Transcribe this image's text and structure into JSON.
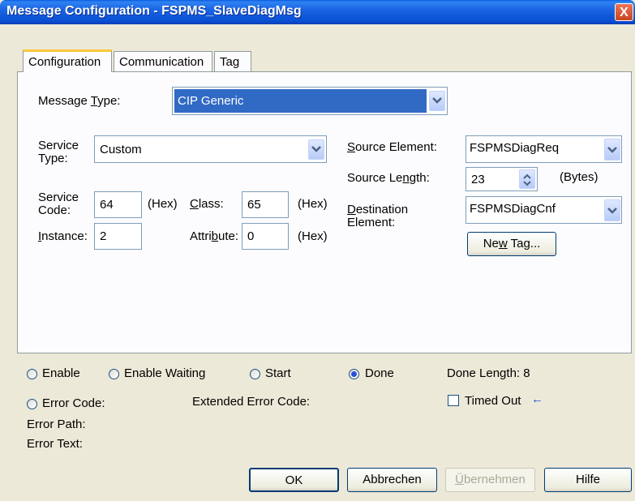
{
  "window": {
    "title": "Message Configuration - FSPMS_SlaveDiagMsg",
    "close_glyph": "X"
  },
  "tabs": [
    {
      "label": "Configuration",
      "active": true
    },
    {
      "label": "Communication",
      "active": false
    },
    {
      "label": "Tag",
      "active": false
    }
  ],
  "config": {
    "message_type": {
      "label_a": "Message ",
      "label_u": "T",
      "label_b": "ype:",
      "value": "CIP Generic"
    },
    "service_type": {
      "label_l1": "Service",
      "label_l2": "Type:",
      "value": "Custom"
    },
    "service_code": {
      "label_l1": "Service",
      "label_l2": "Code:",
      "value": "64",
      "unit": "(Hex)"
    },
    "class": {
      "label_u": "C",
      "label_b": "lass:",
      "value": "65",
      "unit": "(Hex)"
    },
    "instance": {
      "label_u": "I",
      "label_b": "nstance:",
      "value": "2"
    },
    "attribute": {
      "label_a": "Attri",
      "label_u": "b",
      "label_b": "ute:",
      "value": "0",
      "unit": "(Hex)"
    },
    "source_element": {
      "label_u": "S",
      "label_b": "ource Element:",
      "value": "FSPMSDiagReq"
    },
    "source_length": {
      "label_a": "Source Le",
      "label_u": "n",
      "label_b": "gth:",
      "value": "23",
      "unit": "(Bytes)"
    },
    "destination_element": {
      "label_u": "D",
      "label_b": "estination",
      "label_l2": "Element:",
      "value": "FSPMSDiagCnf"
    },
    "new_tag_button": {
      "label_a": "Ne",
      "label_u": "w",
      "label_b": " Tag..."
    }
  },
  "status": {
    "enable": "Enable",
    "enable_waiting": "Enable Waiting",
    "start": "Start",
    "done": "Done",
    "done_length_label": "Done Length: 8",
    "error_code": "Error Code:",
    "extended_error_code": "Extended Error Code:",
    "timed_out": "Timed Out",
    "timed_out_arrow": "←",
    "error_path": "Error Path:",
    "error_text": "Error Text:",
    "selected": "done",
    "timed_out_checked": false
  },
  "buttons": {
    "ok": "OK",
    "cancel": "Abbrechen",
    "apply_u": "Ü",
    "apply_b": "bernehmen",
    "help": "Hilfe"
  },
  "colors": {
    "title_bar": "#0a5fe0",
    "accent_tab": "#ffc83c",
    "dialog_bg": "#ece9d8",
    "radio_dot": "#2a4fd6"
  }
}
